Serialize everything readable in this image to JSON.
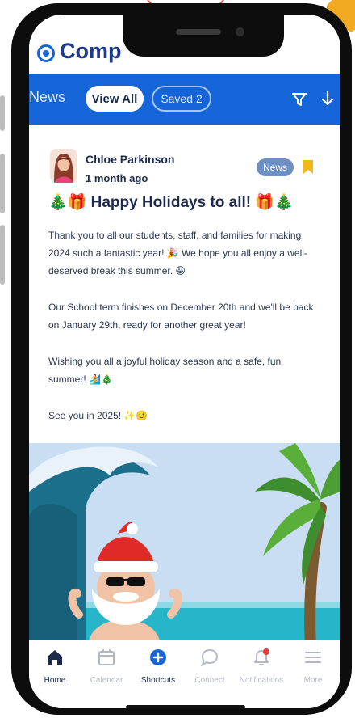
{
  "app": {
    "title": "Comp"
  },
  "nav": {
    "section_label": "News",
    "tabs": [
      {
        "label": "View All",
        "active": true
      },
      {
        "label": "Saved 2",
        "active": false
      }
    ],
    "icons": [
      "filter-icon",
      "download-arrow-icon"
    ]
  },
  "post": {
    "author": "Chloe Parkinson",
    "time_ago": "1 month ago",
    "badge": "News",
    "bookmarked": true,
    "title_emoji_left": "🎄🎁",
    "title": "Happy Holidays to all!",
    "title_emoji_right": "🎁🎄",
    "paragraphs": [
      "Thank you to all our students, staff, and families for making 2024 such a fantastic year! 🎉 We hope you all enjoy a well-deserved break this summer. 😀",
      "Our School term finishes on December 20th and we'll be back on January 29th, ready for another great year!",
      "Wishing you all a joyful holiday season and a safe, fun summer! 🏄🎄",
      "See you in 2025! ✨🙂"
    ]
  },
  "tabbar": {
    "items": [
      {
        "label": "Home",
        "icon": "home-icon",
        "active": true
      },
      {
        "label": "Calendar",
        "icon": "calendar-icon",
        "active": false
      },
      {
        "label": "Shortcuts",
        "icon": "plus-circle-icon",
        "active": true
      },
      {
        "label": "Connect",
        "icon": "chat-bubble-icon",
        "active": false
      },
      {
        "label": "Notifications",
        "icon": "bell-icon",
        "active": false,
        "has_dot": true
      },
      {
        "label": "More",
        "icon": "hamburger-icon",
        "active": false
      }
    ]
  },
  "colors": {
    "brand_blue": "#1565d8",
    "title_navy": "#1e3a8a",
    "badge_blue": "#6e8fc2",
    "bookmark_yellow": "#f2b81b",
    "notification_red": "#e53935",
    "phone_black": "#0d0d0d"
  }
}
